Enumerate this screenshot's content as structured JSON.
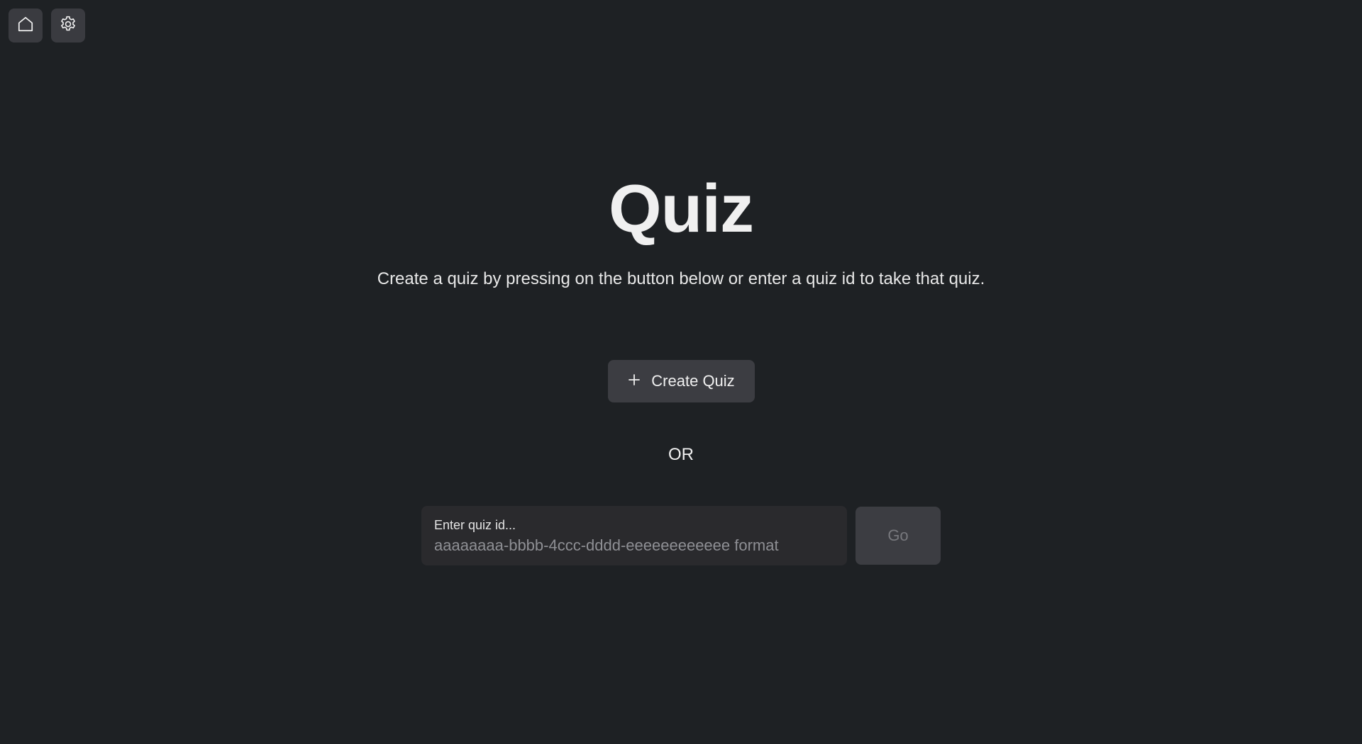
{
  "topbar": {
    "home_icon": "home-icon",
    "settings_icon": "gear-icon"
  },
  "main": {
    "title": "Quiz",
    "subtitle": "Create a quiz by pressing on the button below or enter a quiz id to take that quiz.",
    "create_button": {
      "icon": "plus-icon",
      "label": "Create Quiz"
    },
    "or_text": "OR",
    "quiz_id_input": {
      "label": "Enter quiz id...",
      "value": "",
      "placeholder": "aaaaaaaa-bbbb-4ccc-dddd-eeeeeeeeeeee format"
    },
    "go_button": {
      "label": "Go",
      "disabled": true
    }
  },
  "colors": {
    "background": "#1e2124",
    "button_bg": "#3c3d42",
    "input_bg": "#2a2a2d",
    "text": "#ececec",
    "disabled_text": "#77787d"
  }
}
